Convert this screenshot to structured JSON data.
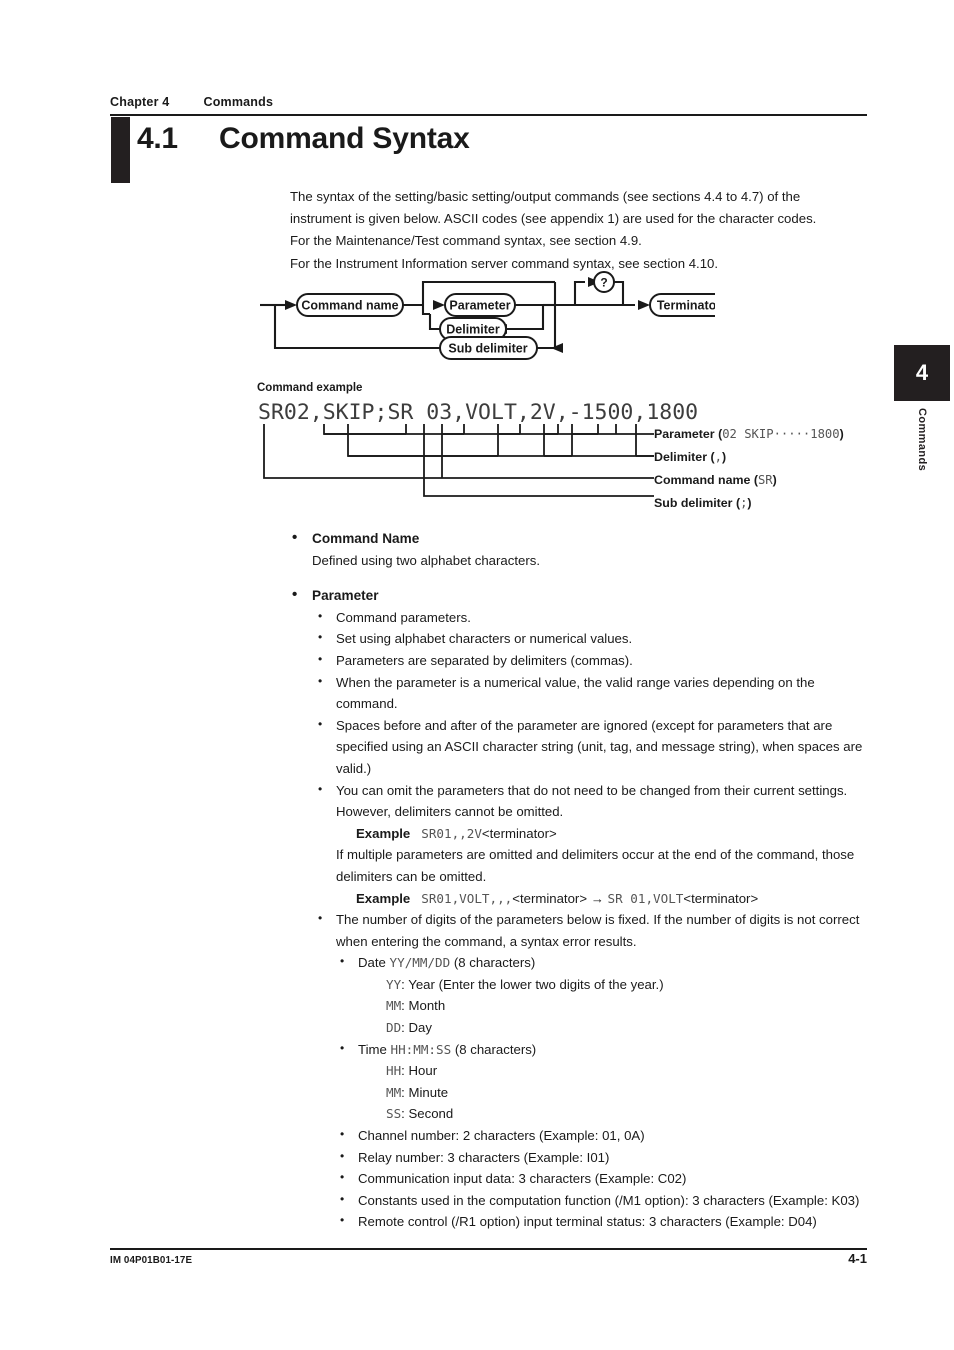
{
  "header": {
    "chapter_number": "Chapter 4",
    "chapter_title": "Commands",
    "section_number": "4.1",
    "section_title": "Command Syntax"
  },
  "side_tab": {
    "number": "4",
    "label": "Commands"
  },
  "intro": {
    "line1": "The syntax of the setting/basic setting/output commands (see sections 4.4 to 4.7) of the",
    "line2": "instrument is given below. ASCII codes (see appendix 1) are used for the character codes.",
    "line3": "For the Maintenance/Test command syntax, see section 4.9.",
    "line4": "For the Instrument Information server command syntax, see section 4.10."
  },
  "syntax_diagram": {
    "nodes": {
      "command_name": "Command name",
      "parameter": "Parameter",
      "delimiter": "Delimiter",
      "sub_delimiter": "Sub delimiter",
      "query": "?",
      "terminator": "Terminator"
    }
  },
  "command_example": {
    "title": "Command example",
    "string": "SR02,SKIP;SR 03,VOLT,2V,-1500,1800",
    "annotations": [
      {
        "label": "Parameter",
        "value": "02 SKIP·····1800"
      },
      {
        "label": "Delimiter",
        "value": ","
      },
      {
        "label": "Command name",
        "value": "SR"
      },
      {
        "label": "Sub delimiter",
        "value": ";"
      }
    ]
  },
  "sections": {
    "command_name": {
      "heading": "Command Name",
      "description": "Defined using two alphabet characters."
    },
    "parameter": {
      "heading": "Parameter",
      "bullets": [
        "Command parameters.",
        "Set using alphabet characters or numerical values.",
        "Parameters are separated by delimiters (commas).",
        "When the parameter is a numerical value, the valid range varies depending on the command.",
        "Spaces before and after of the parameter are ignored (except for parameters that are specified using an ASCII character string (unit, tag, and message string), when spaces are valid.)"
      ],
      "omit_bullet": "You can omit the parameters that do not need to be changed from their current settings. However, delimiters cannot be omitted.",
      "example1_label": "Example",
      "example1_mono": "SR01,,2V",
      "example1_tail": "<terminator>",
      "omit_followup": "If multiple parameters are omitted and delimiters occur at the end of the command, those delimiters can be omitted.",
      "example2_label": "Example",
      "example2_mono_a": "SR01,VOLT,,,",
      "example2_tail_a": "<terminator>",
      "example2_arrow": " → ",
      "example2_mono_b": "SR 01,VOLT",
      "example2_tail_b": "<terminator>",
      "digits_bullet": "The number of digits of the parameters below is fixed. If the number of digits is not correct when entering the command, a syntax error results.",
      "date_label": "Date",
      "date_mono": "YY/MM/DD",
      "date_chars": "(8 characters)",
      "date_defs": [
        {
          "code": "YY",
          "text": ": Year (Enter the lower two digits of the year.)"
        },
        {
          "code": "MM",
          "text": ": Month"
        },
        {
          "code": "DD",
          "text": ": Day"
        }
      ],
      "time_label": "Time",
      "time_mono": "HH:MM:SS",
      "time_chars": "(8 characters)",
      "time_defs": [
        {
          "code": "HH",
          "text": ": Hour"
        },
        {
          "code": "MM",
          "text": ": Minute"
        },
        {
          "code": "SS",
          "text": ": Second"
        }
      ],
      "final_bullets": [
        "Channel number: 2 characters (Example: 01, 0A)",
        "Relay number: 3 characters (Example: I01)",
        "Communication input data: 3 characters (Example: C02)",
        "Constants used in the computation function (/M1 option): 3 characters (Example: K03)",
        "Remote control (/R1 option) input terminal status: 3 characters (Example: D04)"
      ]
    }
  },
  "footer": {
    "document_id": "IM 04P01B01-17E",
    "page_number": "4-1"
  }
}
